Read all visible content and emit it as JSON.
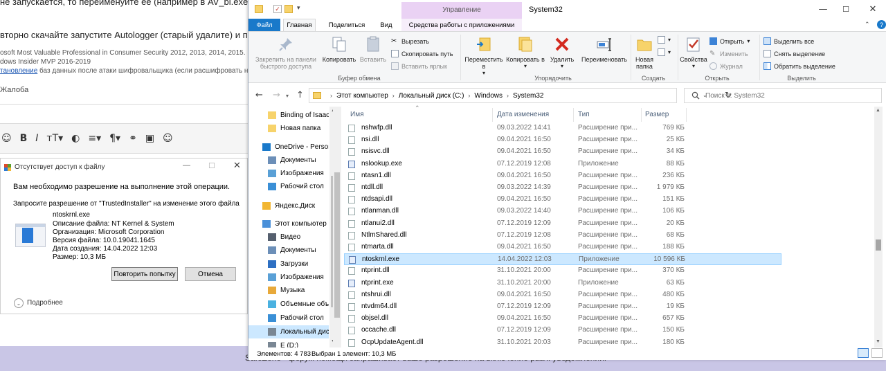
{
  "background_page": {
    "line1": "не запускается, то переименуйте ее (например в AV_bl.exe)",
    "line2": "вторно скачайте запустите Autologger (старый удалите) и прикре",
    "line3": "osoft Most Valuable Professional in Consumer Security 2012, 2013, 2014, 2015.",
    "line4": "dows Insider MVP 2016-2019",
    "line5_link": "тановление",
    "line5_rest": " баз данных после атаки шифровальщика (если расшифровать невоз",
    "complaint": "Жалоба",
    "footer_text": "SafeZone - форум помощи запрашивает ваше разрешение на включение разл. уведомлений.",
    "toolbar_icons": [
      "smile-icon",
      "bold-icon",
      "italic-icon",
      "text-size-icon",
      "palette-icon",
      "align-icon",
      "paragraph-icon",
      "link-icon",
      "image-icon",
      "emoji-icon"
    ]
  },
  "access_dialog": {
    "title": "Отсутствует доступ к файлу",
    "message1": "Вам необходимо разрешение на выполнение этой операции.",
    "message2": "Запросите разрешение от \"TrustedInstaller\" на изменение этого файла",
    "file_name": "ntoskrnl.exe",
    "description": "Описание файла: NT Kernel & System",
    "organization": "Организация: Microsoft Corporation",
    "version": "Версия файла: 10.0.19041.1645",
    "created": "Дата создания: 14.04.2022 12:03",
    "size": "Размер: 10,3 МБ",
    "retry_label": "Повторить попытку",
    "cancel_label": "Отмена",
    "details_label": "Подробнее"
  },
  "explorer": {
    "title": "System32",
    "manage_tab": "Управление",
    "tabs": {
      "file": "Файл",
      "home": "Главная",
      "share": "Поделиться",
      "view": "Вид",
      "tools": "Средства работы с приложениями"
    },
    "ribbon": {
      "pin": "Закрепить на панели быстрого доступа",
      "copy": "Копировать",
      "paste": "Вставить",
      "cut": "Вырезать",
      "copy_path": "Скопировать путь",
      "paste_shortcut": "Вставить ярлык",
      "group_clipboard": "Буфер обмена",
      "move_to": "Переместить в",
      "copy_to": "Копировать в",
      "delete": "Удалить",
      "rename": "Переименовать",
      "group_organize": "Упорядочить",
      "new_folder": "Новая папка",
      "group_create": "Создать",
      "properties": "Свойства",
      "open": "Открыть",
      "edit": "Изменить",
      "history": "Журнал",
      "group_open": "Открыть",
      "select_all": "Выделить все",
      "select_none": "Снять выделение",
      "invert_selection": "Обратить выделение",
      "group_select": "Выделить"
    },
    "breadcrumbs": [
      "Этот компьютер",
      "Локальный диск (C:)",
      "Windows",
      "System32"
    ],
    "search_placeholder": "Поиск в: System32",
    "nav_items": [
      {
        "label": "Binding of Isaac",
        "icon": "folder-icon",
        "color": "#f7d36b"
      },
      {
        "label": "Новая папка",
        "icon": "folder-icon",
        "color": "#f7d36b"
      },
      {
        "label": "OneDrive - Person",
        "icon": "cloud-icon",
        "color": "#1979ca"
      },
      {
        "label": "Документы",
        "icon": "documents-icon",
        "color": "#6c8fb8"
      },
      {
        "label": "Изображения",
        "icon": "pictures-icon",
        "color": "#5aa0d6"
      },
      {
        "label": "Рабочий стол",
        "icon": "desktop-icon",
        "color": "#3a8fd6"
      },
      {
        "label": "Яндекс.Диск",
        "icon": "yandex-disk-icon",
        "color": "#f2b632"
      },
      {
        "label": "Этот компьютер",
        "icon": "computer-icon",
        "color": "#4a90d9"
      },
      {
        "label": "Видео",
        "icon": "video-icon",
        "color": "#555f6e"
      },
      {
        "label": "Документы",
        "icon": "documents-icon",
        "color": "#6c8fb8"
      },
      {
        "label": "Загрузки",
        "icon": "downloads-icon",
        "color": "#2d6fc2"
      },
      {
        "label": "Изображения",
        "icon": "pictures-icon",
        "color": "#5aa0d6"
      },
      {
        "label": "Музыка",
        "icon": "music-icon",
        "color": "#e8a93a"
      },
      {
        "label": "Объемные объ",
        "icon": "3d-objects-icon",
        "color": "#4ab1e0"
      },
      {
        "label": "Рабочий стол",
        "icon": "desktop-icon",
        "color": "#3a8fd6"
      },
      {
        "label": "Локальный дис",
        "icon": "drive-icon",
        "color": "#7a8794"
      },
      {
        "label": "E (D:)",
        "icon": "drive-icon",
        "color": "#7a8794"
      }
    ],
    "columns": {
      "name": "Имя",
      "date": "Дата изменения",
      "type": "Тип",
      "size": "Размер"
    },
    "files": [
      {
        "name": "nshwfp.dll",
        "date": "09.03.2022 14:41",
        "type": "Расширение при...",
        "size": "769 КБ",
        "kind": "dll"
      },
      {
        "name": "nsi.dll",
        "date": "09.04.2021 16:50",
        "type": "Расширение при...",
        "size": "25 КБ",
        "kind": "dll"
      },
      {
        "name": "nsisvc.dll",
        "date": "09.04.2021 16:50",
        "type": "Расширение при...",
        "size": "34 КБ",
        "kind": "dll"
      },
      {
        "name": "nslookup.exe",
        "date": "07.12.2019 12:08",
        "type": "Приложение",
        "size": "88 КБ",
        "kind": "exe"
      },
      {
        "name": "ntasn1.dll",
        "date": "09.04.2021 16:50",
        "type": "Расширение при...",
        "size": "236 КБ",
        "kind": "dll"
      },
      {
        "name": "ntdll.dll",
        "date": "09.03.2022 14:39",
        "type": "Расширение при...",
        "size": "1 979 КБ",
        "kind": "dll"
      },
      {
        "name": "ntdsapi.dll",
        "date": "09.04.2021 16:50",
        "type": "Расширение при...",
        "size": "151 КБ",
        "kind": "dll"
      },
      {
        "name": "ntlanman.dll",
        "date": "09.03.2022 14:40",
        "type": "Расширение при...",
        "size": "106 КБ",
        "kind": "dll"
      },
      {
        "name": "ntlanui2.dll",
        "date": "07.12.2019 12:09",
        "type": "Расширение при...",
        "size": "20 КБ",
        "kind": "dll"
      },
      {
        "name": "NtlmShared.dll",
        "date": "07.12.2019 12:08",
        "type": "Расширение при...",
        "size": "68 КБ",
        "kind": "dll"
      },
      {
        "name": "ntmarta.dll",
        "date": "09.04.2021 16:50",
        "type": "Расширение при...",
        "size": "188 КБ",
        "kind": "dll"
      },
      {
        "name": "ntoskrnl.exe",
        "date": "14.04.2022 12:03",
        "type": "Приложение",
        "size": "10 596 КБ",
        "kind": "exe",
        "selected": true
      },
      {
        "name": "ntprint.dll",
        "date": "31.10.2021 20:00",
        "type": "Расширение при...",
        "size": "370 КБ",
        "kind": "dll"
      },
      {
        "name": "ntprint.exe",
        "date": "31.10.2021 20:00",
        "type": "Приложение",
        "size": "63 КБ",
        "kind": "exe"
      },
      {
        "name": "ntshrui.dll",
        "date": "09.04.2021 16:50",
        "type": "Расширение при...",
        "size": "480 КБ",
        "kind": "dll"
      },
      {
        "name": "ntvdm64.dll",
        "date": "07.12.2019 12:09",
        "type": "Расширение при...",
        "size": "19 КБ",
        "kind": "dll"
      },
      {
        "name": "objsel.dll",
        "date": "09.04.2021 16:50",
        "type": "Расширение при...",
        "size": "657 КБ",
        "kind": "dll"
      },
      {
        "name": "occache.dll",
        "date": "07.12.2019 12:09",
        "type": "Расширение при...",
        "size": "150 КБ",
        "kind": "dll"
      },
      {
        "name": "OcpUpdateAgent.dll",
        "date": "31.10.2021 20:03",
        "type": "Расширение при...",
        "size": "180 КБ",
        "kind": "dll"
      }
    ],
    "status": {
      "count": "Элементов: 4 783",
      "selected": "Выбран 1 элемент: 10,3 МБ"
    }
  }
}
